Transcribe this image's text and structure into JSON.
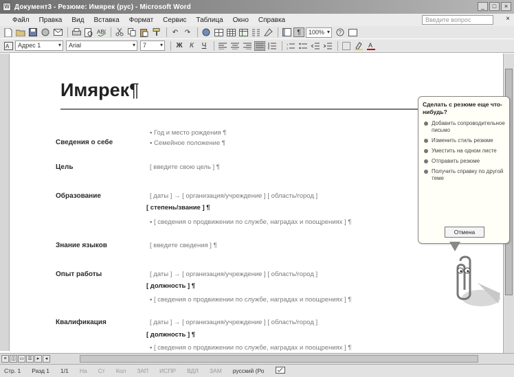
{
  "window": {
    "title": "Документ3 - Резюме: Имярек (рус) - Microsoft Word",
    "controls": [
      "_",
      "□",
      "×"
    ]
  },
  "menubar": {
    "items": [
      "Файл",
      "Правка",
      "Вид",
      "Вставка",
      "Формат",
      "Сервис",
      "Таблица",
      "Окно",
      "Справка"
    ],
    "help_placeholder": "Введите вопрос"
  },
  "toolbar_standard": {
    "zoom": "100%"
  },
  "toolbar_format": {
    "style": "Адрес 1",
    "font": "Arial",
    "size": "7"
  },
  "document": {
    "name": "Имярек",
    "pilcrow": "¶",
    "sections": [
      {
        "label": "Сведения о себе",
        "lines": [
          {
            "text": "▪ Год и место рождения ¶",
            "bold": false
          },
          {
            "text": "▪ Семейное положение ¶",
            "bold": false
          }
        ]
      },
      {
        "label": "Цель",
        "lines": [
          {
            "text": "[ введите свою цель ] ¶",
            "bold": false
          }
        ]
      },
      {
        "label": "Образование",
        "lines": [
          {
            "text": "[ даты ]     →     [ организация/учреждение ]  [ область/город ]",
            "bold": false
          },
          {
            "text": "[ степень/звание ] ¶",
            "bold": true
          },
          {
            "text": "▪ [ сведения о продвижении по службе, наградах и поощрениях ] ¶",
            "bold": false
          }
        ]
      },
      {
        "label": "Знание языков",
        "lines": [
          {
            "text": "[ введите сведения ] ¶",
            "bold": false
          }
        ]
      },
      {
        "label": "Опыт работы",
        "lines": [
          {
            "text": "[ даты ]     →     [ организация/учреждение ]  [ область/город ]",
            "bold": false
          },
          {
            "text": "[ должность ] ¶",
            "bold": true
          },
          {
            "text": "▪ [ сведения о продвижении по службе, наградах и поощрениях ] ¶",
            "bold": false
          }
        ]
      },
      {
        "label": "Квалификация",
        "lines": [
          {
            "text": "[ даты ]     →     [ организация/учреждение ]  [ область/город ]",
            "bold": false
          },
          {
            "text": "[ должность ] ¶",
            "bold": true
          },
          {
            "text": "▪ [ сведения о продвижении по службе, наградах и поощрениях ] ¶",
            "bold": false
          }
        ]
      }
    ]
  },
  "assistant": {
    "question": "Сделать с резюме еще что-нибудь?",
    "options": [
      "Добавить сопроводительное письмо",
      "Изменить стиль резюме",
      "Уместить на одном листе",
      "Отправить резюме",
      "Получить справку по другой теме"
    ],
    "cancel": "Отмена"
  },
  "statusbar": {
    "page": "Стр. 1",
    "section": "Разд 1",
    "pages": "1/1",
    "position": "На",
    "line": "Ст",
    "column": "Кол",
    "rec": "ЗАП",
    "trk": "ИСПР",
    "ext": "ВДЛ",
    "ovr": "ЗАМ",
    "language": "русский (Ро"
  },
  "colors": {
    "accent": "#6f6f6f",
    "text": "#222222",
    "placeholder_text": "#7a7a7a"
  }
}
